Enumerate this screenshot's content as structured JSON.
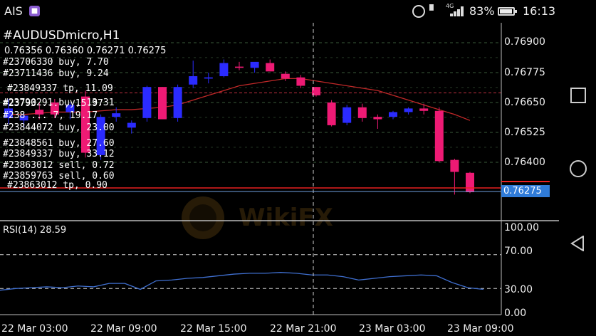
{
  "status_bar": {
    "carrier": "AIS",
    "app_badge": "■",
    "network_type": "4G",
    "battery_percent": "83%",
    "time": "16:13"
  },
  "chart": {
    "header_lines": [
      "#AUDUSDmicro,H1",
      "0.76356 0.76360 0.76271 0.76275"
    ],
    "order_labels": [
      "#23706330 buy, 7.70",
      "#23711436 buy, 9.24",
      "#23849337 tp, 11.09",
      "#23790291 buy, 13.31",
      "#23793 ... , 15.97",
      "#238 ... 7, 19.17",
      "#23844072 buy, 23.00",
      "#23848561 buy, 27.60",
      "#23849337 buy, 33.12",
      "#23863012 sell, 0.72",
      "#23859763 sell, 0.60",
      "#23863012 tp, 0.90"
    ],
    "price_levels": [
      "0.76900",
      "0.76775",
      "0.76650",
      "0.76525",
      "0.76400"
    ],
    "current_price": "0.76275",
    "rsi_title": "RSI(14) 28.59",
    "rsi_levels": [
      "100.00",
      "70.00",
      "30.00",
      "0.00"
    ],
    "time_labels": [
      "22 Mar 03:00",
      "22 Mar 09:00",
      "22 Mar 15:00",
      "22 Mar 21:00",
      "23 Mar 03:00",
      "23 Mar 09:00"
    ],
    "watermark": "WikiFX",
    "colors": {
      "bull": "#2b2bff",
      "bear": "#ee1a74",
      "ma": "#c02828",
      "rsi": "#3f6fd0",
      "price_badge": "#2f7bd8"
    }
  },
  "chart_data": {
    "type": "candlestick",
    "symbol": "AUDUSDmicro",
    "timeframe": "H1",
    "ylim": [
      0.7622,
      0.7698
    ],
    "candles": [
      {
        "o": 0.76585,
        "h": 0.76665,
        "l": 0.7656,
        "c": 0.76625
      },
      {
        "o": 0.76575,
        "h": 0.7661,
        "l": 0.76545,
        "c": 0.76595
      },
      {
        "o": 0.7662,
        "h": 0.7665,
        "l": 0.7658,
        "c": 0.766
      },
      {
        "o": 0.7665,
        "h": 0.76665,
        "l": 0.76585,
        "c": 0.766
      },
      {
        "o": 0.7661,
        "h": 0.7665,
        "l": 0.7658,
        "c": 0.7664
      },
      {
        "o": 0.76675,
        "h": 0.767,
        "l": 0.7642,
        "c": 0.7644
      },
      {
        "o": 0.7643,
        "h": 0.766,
        "l": 0.7641,
        "c": 0.7659
      },
      {
        "o": 0.7659,
        "h": 0.7663,
        "l": 0.7657,
        "c": 0.76605
      },
      {
        "o": 0.76545,
        "h": 0.76575,
        "l": 0.7652,
        "c": 0.76565
      },
      {
        "o": 0.76585,
        "h": 0.7672,
        "l": 0.7657,
        "c": 0.76715
      },
      {
        "o": 0.76715,
        "h": 0.76715,
        "l": 0.7658,
        "c": 0.7658
      },
      {
        "o": 0.76585,
        "h": 0.76725,
        "l": 0.7657,
        "c": 0.76715
      },
      {
        "o": 0.76725,
        "h": 0.76825,
        "l": 0.7671,
        "c": 0.7676
      },
      {
        "o": 0.7675,
        "h": 0.76775,
        "l": 0.7673,
        "c": 0.76755
      },
      {
        "o": 0.7676,
        "h": 0.7683,
        "l": 0.76755,
        "c": 0.76815
      },
      {
        "o": 0.768,
        "h": 0.7682,
        "l": 0.76785,
        "c": 0.76795
      },
      {
        "o": 0.76795,
        "h": 0.76815,
        "l": 0.76775,
        "c": 0.7682
      },
      {
        "o": 0.76815,
        "h": 0.7683,
        "l": 0.7678,
        "c": 0.7678
      },
      {
        "o": 0.7677,
        "h": 0.7678,
        "l": 0.7674,
        "c": 0.7675
      },
      {
        "o": 0.76755,
        "h": 0.76765,
        "l": 0.7671,
        "c": 0.7672
      },
      {
        "o": 0.76715,
        "h": 0.76715,
        "l": 0.76675,
        "c": 0.7668
      },
      {
        "o": 0.7665,
        "h": 0.7666,
        "l": 0.7655,
        "c": 0.76555
      },
      {
        "o": 0.76565,
        "h": 0.7664,
        "l": 0.76555,
        "c": 0.7663
      },
      {
        "o": 0.7663,
        "h": 0.76645,
        "l": 0.7657,
        "c": 0.76585
      },
      {
        "o": 0.7659,
        "h": 0.766,
        "l": 0.7654,
        "c": 0.7658
      },
      {
        "o": 0.7659,
        "h": 0.76615,
        "l": 0.7658,
        "c": 0.7661
      },
      {
        "o": 0.7661,
        "h": 0.7663,
        "l": 0.766,
        "c": 0.76625
      },
      {
        "o": 0.76625,
        "h": 0.76645,
        "l": 0.766,
        "c": 0.76615
      },
      {
        "o": 0.76615,
        "h": 0.7663,
        "l": 0.764,
        "c": 0.76405
      },
      {
        "o": 0.7641,
        "h": 0.76415,
        "l": 0.76265,
        "c": 0.7636
      },
      {
        "o": 0.76356,
        "h": 0.7636,
        "l": 0.76271,
        "c": 0.76275
      }
    ],
    "ma": [
      0.766,
      0.766,
      0.76605,
      0.7661,
      0.7661,
      0.7661,
      0.76615,
      0.7662,
      0.7662,
      0.76625,
      0.7663,
      0.7664,
      0.7666,
      0.7668,
      0.767,
      0.7672,
      0.7673,
      0.7674,
      0.7675,
      0.7675,
      0.7674,
      0.7673,
      0.7672,
      0.7671,
      0.767,
      0.7668,
      0.7666,
      0.7664,
      0.7662,
      0.766,
      0.76575
    ],
    "rsi_ylim": [
      0,
      100
    ],
    "rsi": [
      28,
      30,
      31,
      32,
      31,
      33,
      32,
      36,
      36,
      29,
      39,
      40,
      42,
      43,
      45,
      47,
      48,
      48,
      49,
      48,
      46,
      46,
      44,
      40,
      42,
      44,
      45,
      46,
      45,
      37,
      31,
      29
    ]
  }
}
